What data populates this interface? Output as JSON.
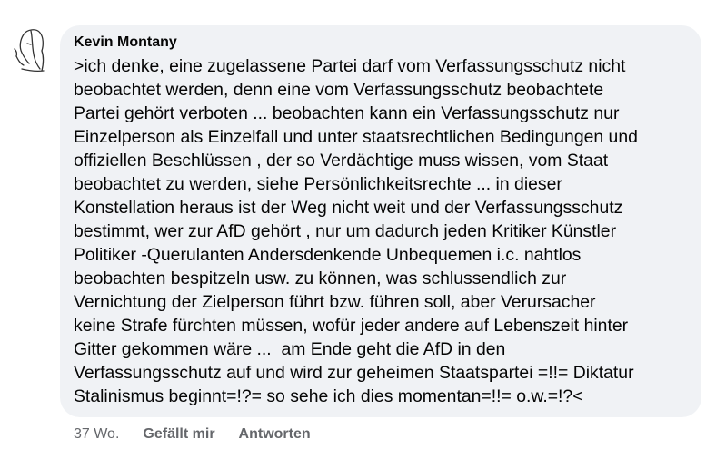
{
  "comment": {
    "author": "Kevin Montany",
    "avatar_icon": "line-drawing-portrait-icon",
    "text_lines": [
      ">ich denke, eine zugelassene Partei darf vom Verfassungsschutz nicht",
      "beobachtet werden, denn eine vom Verfassungsschutz beobachtete",
      "Partei gehört verboten ... beobachten kann ein Verfassungsschutz nur",
      "Einzelperson als Einzelfall und unter staatsrechtlichen Bedingungen und",
      "offiziellen Beschlüssen , der so Verdächtige muss wissen, vom Staat",
      "beobachtet zu werden, siehe Persönlichkeitsrechte ... in dieser",
      "Konstellation heraus ist der Weg nicht weit und der Verfassungsschutz",
      "bestimmt, wer zur AfD gehört , nur um dadurch jeden Kritiker Künstler",
      "Politiker -Querulanten Andersdenkende Unbequemen i.c. nahtlos",
      "beobachten bespitzeln usw. zu können, was schlussendlich zur",
      "Vernichtung der Zielperson führt bzw. führen soll, aber Verursacher",
      "keine Strafe fürchten müssen, wofür jeder andere auf Lebenszeit hinter",
      "Gitter gekommen wäre ...  am Ende geht die AfD in den",
      "Verfassungsschutz auf und wird zur geheimen Staatspartei =!!= Diktatur",
      "Stalinismus beginnt=!?= so sehe ich dies momentan=!!= o.w.=!?<"
    ],
    "timestamp": "37 Wo.",
    "like_label": "Gefällt mir",
    "reply_label": "Antworten"
  },
  "colors": {
    "bubble_bg": "#f0f2f5",
    "text": "#050505",
    "secondary_text": "#65676b"
  }
}
